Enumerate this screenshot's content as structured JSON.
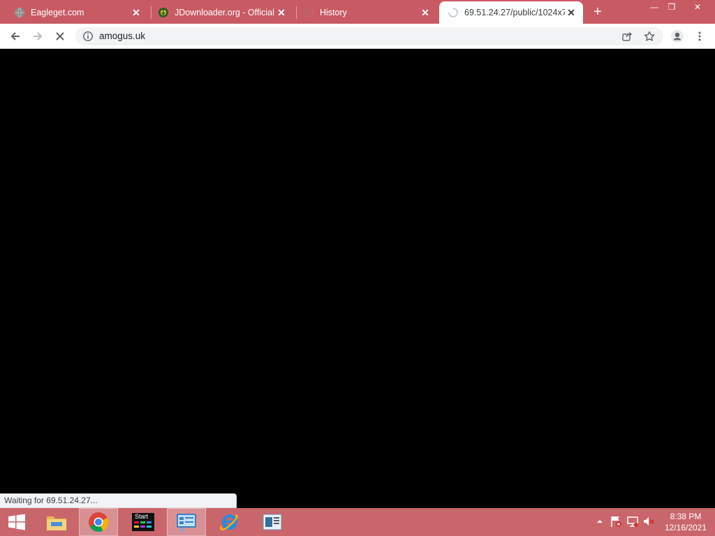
{
  "browser": {
    "tabs": [
      {
        "title": "Eagleget.com",
        "favicon": "globe-icon"
      },
      {
        "title": "JDownloader.org - Official",
        "favicon": "jdownloader-icon"
      },
      {
        "title": "History",
        "favicon": "history-icon"
      },
      {
        "title": "69.51.24.27/public/1024x7",
        "favicon": "loading-spinner-icon"
      }
    ],
    "new_tab_label": "+",
    "window_controls": {
      "minimize": "—",
      "restore": "❐",
      "close": "✕"
    },
    "url": "amogus.uk",
    "status_text": "Waiting for 69.51.24.27..."
  },
  "taskbar": {
    "apps": [
      "start-icon",
      "file-explorer-icon",
      "chrome-icon",
      "start-app-icon",
      "control-panel-icon",
      "internet-explorer-icon",
      "notepad-icon"
    ],
    "start_app_label": "Start",
    "time": "8:38 PM",
    "date": "12/16/2021"
  },
  "colors": {
    "tabstrip": "#c85a64",
    "taskbar": "#c9666c",
    "content": "#000000"
  }
}
